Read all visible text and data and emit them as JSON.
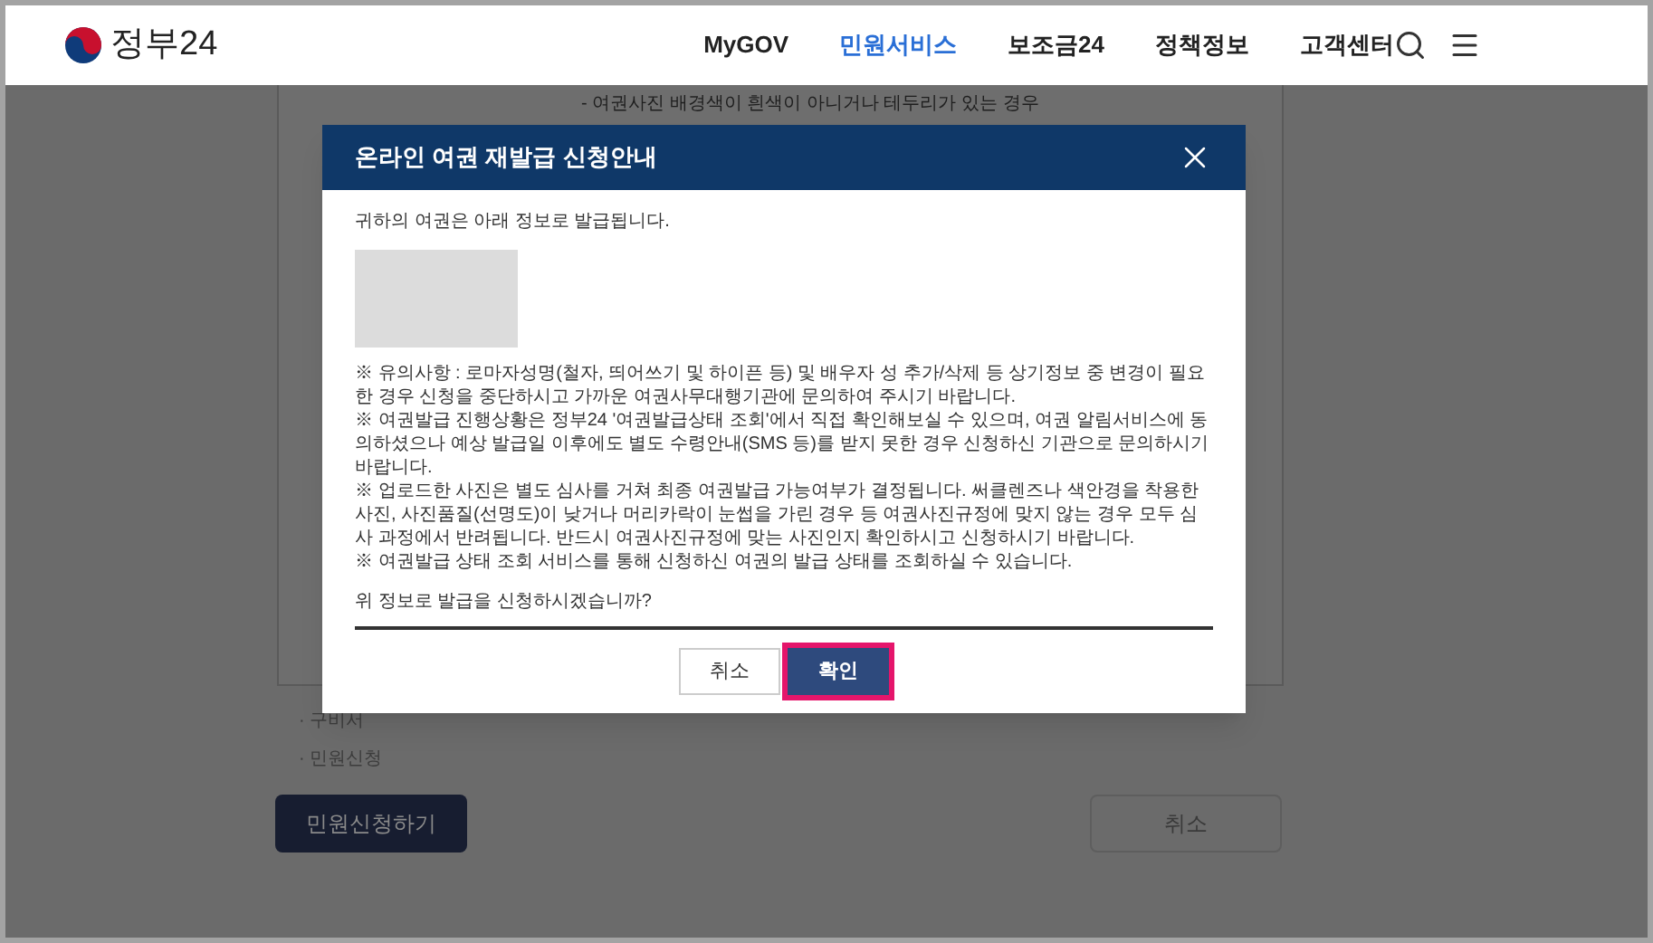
{
  "header": {
    "logo_text": "정부24",
    "nav": [
      {
        "label": "MyGOV",
        "selected": false
      },
      {
        "label": "민원서비스",
        "selected": true
      },
      {
        "label": "보조금24",
        "selected": false
      },
      {
        "label": "정책정보",
        "selected": false
      },
      {
        "label": "고객센터",
        "selected": false
      }
    ]
  },
  "background_page": {
    "top_text": "- 여권사진 배경색이 흰색이 아니거나 테두리가 있는 경우",
    "bullets": [
      "· 구비서",
      "· 민원신청"
    ],
    "apply_button": "민원신청하기",
    "cancel_button": "취소"
  },
  "dialog": {
    "title": "온라인 여권 재발급 신청안내",
    "intro": "귀하의 여권은 아래 정보로 발급됩니다.",
    "notes": [
      "※ 유의사항 : 로마자성명(철자, 띄어쓰기 및 하이픈 등) 및 배우자 성 추가/삭제 등 상기정보 중 변경이 필요한 경우 신청을 중단하시고 가까운 여권사무대행기관에 문의하여 주시기 바랍니다.",
      "※ 여권발급 진행상황은 정부24 '여권발급상태 조회'에서 직접 확인해보실 수 있으며, 여권 알림서비스에 동의하셨으나 예상 발급일 이후에도 별도 수령안내(SMS 등)를 받지 못한 경우 신청하신 기관으로 문의하시기 바랍니다.",
      "※ 업로드한 사진은 별도 심사를 거쳐 최종 여권발급 가능여부가 결정됩니다. 써클렌즈나 색안경을 착용한 사진, 사진품질(선명도)이 낮거나 머리카락이 눈썹을 가린 경우 등 여권사진규정에 맞지 않는 경우 모두 심사 과정에서 반려됩니다. 반드시 여권사진규정에 맞는 사진인지 확인하시고 신청하시기 바랍니다.",
      "※ 여권발급 상태 조회 서비스를 통해 신청하신 여권의 발급 상태를 조회하실 수 있습니다."
    ],
    "question": "위 정보로 발급을 신청하시겠습니까?",
    "buttons": [
      {
        "label": "취소",
        "kind": "secondary",
        "highlighted": false
      },
      {
        "label": "확인",
        "kind": "primary",
        "highlighted": true
      }
    ]
  }
}
